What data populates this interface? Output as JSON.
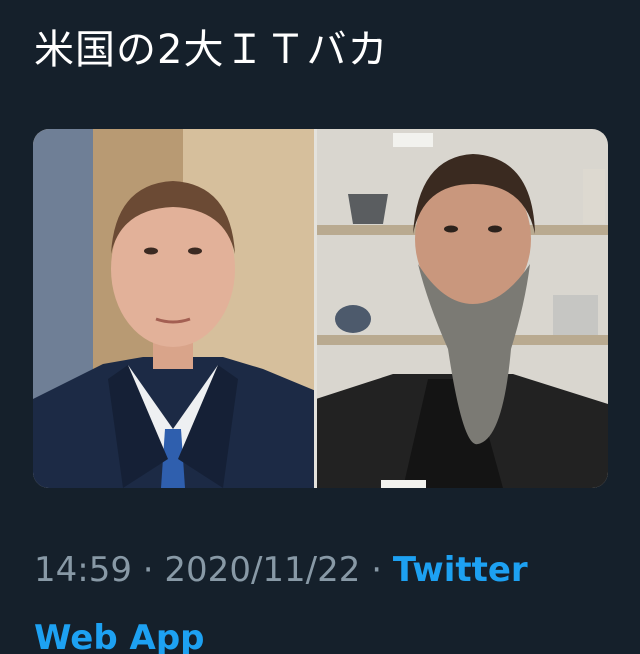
{
  "tweet": {
    "text": "米国の2大ＩＴバカ"
  },
  "media": {
    "left_image": "photo-man-in-suit",
    "right_image": "photo-man-with-beard"
  },
  "meta": {
    "time": "14:59",
    "separator_1": " · ",
    "date": "2020/11/22",
    "separator_2": " · ",
    "source": "Twitter Web App"
  },
  "colors": {
    "background": "#15202b",
    "text": "#ffffff",
    "secondary": "#8899a6",
    "link": "#1da1f2"
  }
}
